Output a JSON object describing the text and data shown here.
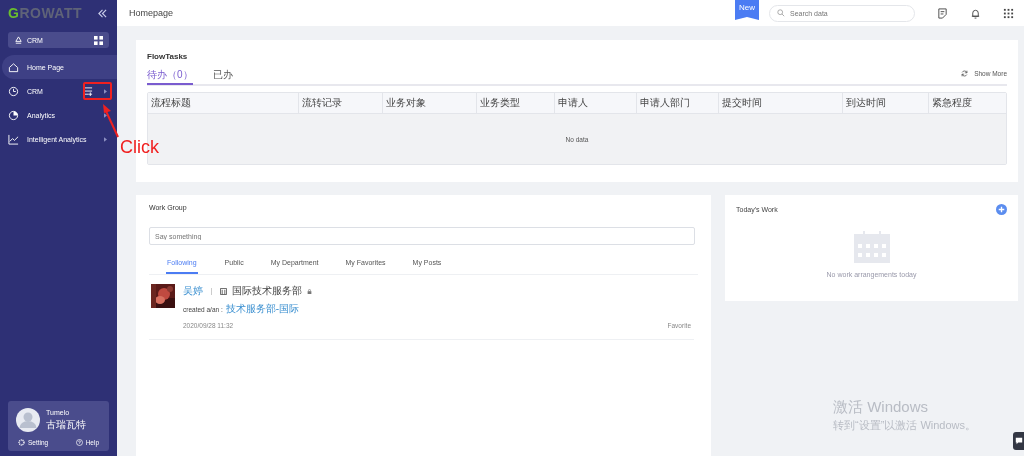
{
  "sidebar": {
    "logo": {
      "first": "G",
      "rest": "ROWATT"
    },
    "app_switcher": {
      "label": "CRM"
    },
    "nav": [
      {
        "label": "Home Page",
        "kind": "home",
        "selected": true,
        "expandable": false
      },
      {
        "label": "CRM",
        "kind": "clock",
        "selected": false,
        "expandable": true
      },
      {
        "label": "Analytics",
        "kind": "pie",
        "selected": false,
        "expandable": true
      },
      {
        "label": "Intelligent Analytics",
        "kind": "chart",
        "selected": false,
        "expandable": true
      }
    ],
    "user": {
      "name": "Tumelo",
      "company": "古瑞瓦特",
      "actions": [
        {
          "label": "Setting",
          "kind": "gear"
        },
        {
          "label": "Help",
          "kind": "help"
        }
      ]
    }
  },
  "header": {
    "title": "Homepage",
    "badge": "New",
    "search": {
      "placeholder": "Search data"
    }
  },
  "flow_tasks": {
    "title": "FlowTasks",
    "tabs": [
      {
        "label": "待办（0）",
        "selected": true
      },
      {
        "label": "已办",
        "selected": false
      }
    ],
    "show_more": "Show More",
    "columns": [
      "流程标题",
      "流转记录",
      "业务对象",
      "业务类型",
      "申请人",
      "申请人部门",
      "提交时间",
      "到达时间",
      "紧急程度"
    ],
    "empty": "No data"
  },
  "work_group": {
    "title": "Work Group",
    "input": {
      "placeholder": "Say something"
    },
    "tabs": [
      {
        "label": "Following",
        "selected": true
      },
      {
        "label": "Public",
        "selected": false
      },
      {
        "label": "My Department",
        "selected": false
      },
      {
        "label": "My Favorites",
        "selected": false
      },
      {
        "label": "My Posts",
        "selected": false
      }
    ],
    "posts": [
      {
        "author": "吴婷",
        "department": "国际技术服务部",
        "locked": true,
        "action": "created a/an :",
        "target": "技术服务部-国际",
        "time": "2020/09/28 11:32",
        "favorite": "Favorite"
      }
    ]
  },
  "todays_work": {
    "title": "Today's Work",
    "empty": "No work arrangements today"
  },
  "annotation": {
    "text": "Click"
  },
  "os_notice": {
    "title": "激活 Windows",
    "subtitle": "转到“设置”以激活 Windows。"
  }
}
